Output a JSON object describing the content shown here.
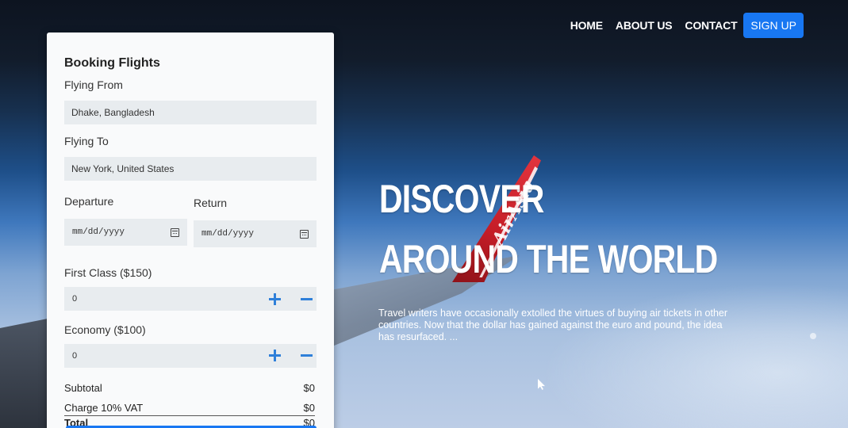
{
  "nav": {
    "items": [
      "HOME",
      "ABOUT US",
      "CONTACT"
    ],
    "signup_label": "SIGN UP"
  },
  "hero": {
    "line1": "DISCOVER",
    "line2": "AROUND THE WORLD",
    "description": "Travel writers have occasionally extolled the virtues of buying air tickets in other countries. Now that the dollar has gained against the euro and pound, the idea has resurfaced. ...",
    "tail_logo": "AirAsia"
  },
  "booking": {
    "title": "Booking Flights",
    "from_label": "Flying From",
    "from_value": "Dhake, Bangladesh",
    "to_label": "Flying To",
    "to_value": "New York, United States",
    "departure_label": "Departure",
    "return_label": "Return",
    "date_placeholder": "mm/dd/yyyy",
    "first_class_label": "First Class ($150)",
    "first_class_qty": "0",
    "economy_label": "Economy ($100)",
    "economy_qty": "0",
    "subtotal_label": "Subtotal",
    "subtotal_value": "$0",
    "vat_label": "Charge 10% VAT",
    "vat_value": "$0",
    "total_label": "Total",
    "total_value": "$0"
  },
  "colors": {
    "accent": "#1877f2",
    "icon_blue": "#2f80d9",
    "tail_red": "#d32630"
  }
}
